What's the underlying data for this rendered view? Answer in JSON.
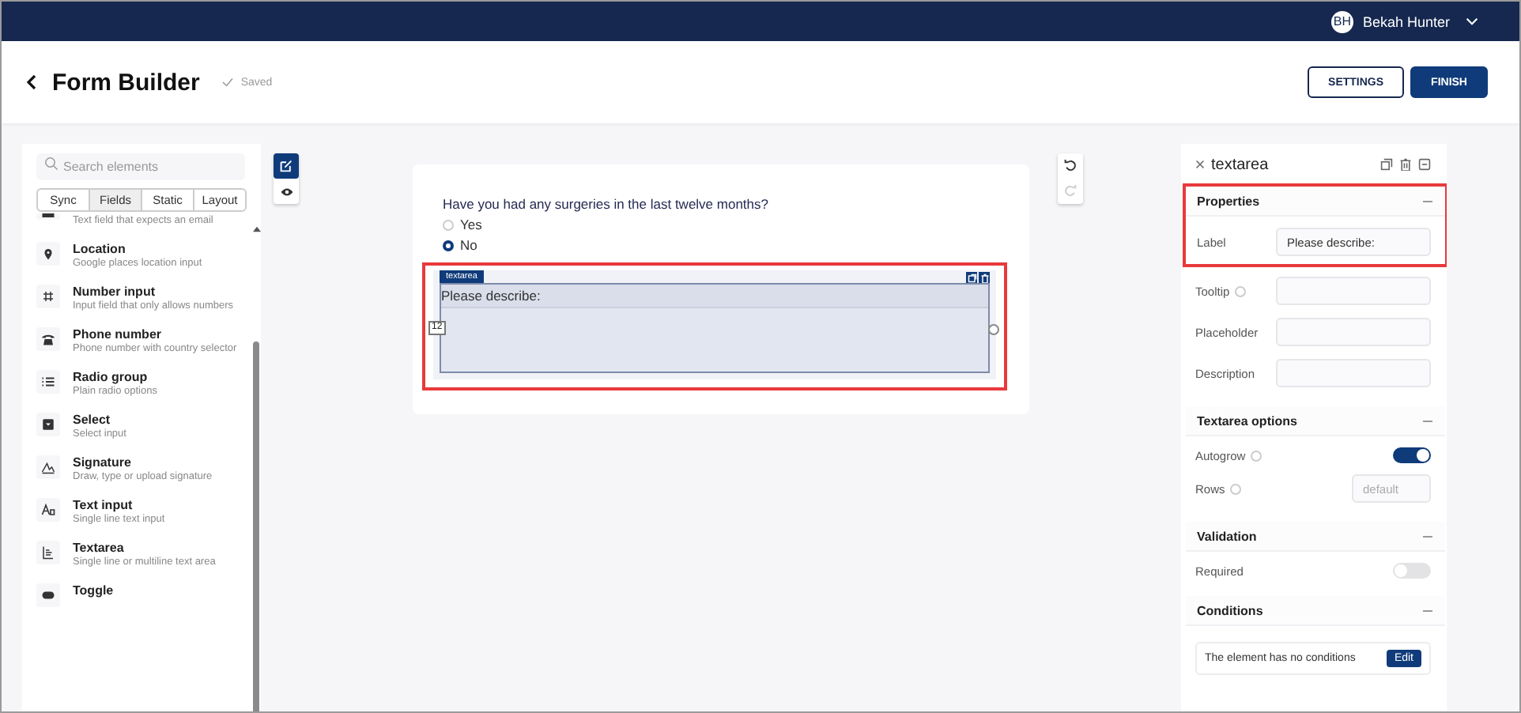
{
  "topbar": {
    "user": {
      "initials": "BH",
      "name": "Bekah Hunter"
    }
  },
  "header": {
    "title": "Form Builder",
    "status": "Saved",
    "buttons": [
      {
        "label": "SETTINGS",
        "kind": "outline"
      },
      {
        "label": "FINISH",
        "kind": "primary"
      }
    ]
  },
  "sidebar": {
    "search": {
      "placeholder": "Search elements"
    },
    "tabs": [
      {
        "label": "Sync",
        "selected": false
      },
      {
        "label": "Fields",
        "selected": true
      },
      {
        "label": "Static",
        "selected": false
      },
      {
        "label": "Layout",
        "selected": false
      }
    ],
    "items": [
      {
        "kind": "email",
        "description": "Text field that expects an email"
      },
      {
        "kind": "location",
        "title": "Location",
        "description": "Google places location input"
      },
      {
        "kind": "number",
        "title": "Number input",
        "description": "Input field that only allows numbers"
      },
      {
        "kind": "phone",
        "title": "Phone number",
        "description": "Phone number with country selector"
      },
      {
        "kind": "radio",
        "title": "Radio group",
        "description": "Plain radio options"
      },
      {
        "kind": "select",
        "title": "Select",
        "description": "Select input"
      },
      {
        "kind": "signature",
        "title": "Signature",
        "description": "Draw, type or upload signature"
      },
      {
        "kind": "text",
        "title": "Text input",
        "description": "Single line text input"
      },
      {
        "kind": "textarea",
        "title": "Textarea",
        "description": "Single line or multiline text area"
      },
      {
        "kind": "toggle",
        "title": "Toggle"
      }
    ]
  },
  "view_modes": [
    {
      "kind": "edit",
      "selected": true
    },
    {
      "kind": "preview",
      "selected": false
    }
  ],
  "history": [
    {
      "kind": "undo",
      "disabled": false
    },
    {
      "kind": "redo",
      "disabled": true
    }
  ],
  "canvas": {
    "question": "Have you had any surgeries in the last twelve months?",
    "options": [
      {
        "label": "Yes",
        "selected": false
      },
      {
        "label": "No",
        "selected": true
      }
    ],
    "element": {
      "tag": "textarea",
      "label": "Please describe:",
      "width_badge": "12",
      "highlighted": true
    }
  },
  "inspector": {
    "title": "textarea",
    "sections": [
      {
        "title": "Properties",
        "expanded": true,
        "highlighted": true,
        "rows": [
          {
            "kind": "field",
            "label": "Label",
            "value": "Please describe:"
          },
          {
            "kind": "field",
            "label": "Tooltip",
            "info": true
          },
          {
            "kind": "field",
            "label": "Placeholder"
          },
          {
            "kind": "field",
            "label": "Description"
          }
        ]
      },
      {
        "title": "Textarea options",
        "expanded": true,
        "highlighted": false,
        "rows": [
          {
            "kind": "toggle",
            "label": "Autogrow",
            "info": true,
            "on": true
          },
          {
            "kind": "short-field",
            "label": "Rows",
            "info": true,
            "placeholder": "default"
          }
        ]
      },
      {
        "title": "Validation",
        "expanded": true,
        "highlighted": false,
        "rows": [
          {
            "kind": "toggle",
            "label": "Required",
            "on": false
          }
        ]
      },
      {
        "title": "Conditions",
        "expanded": true,
        "highlighted": false,
        "rows": [
          {
            "kind": "conditions",
            "text": "The element has no conditions",
            "button": "Edit"
          }
        ]
      }
    ]
  }
}
